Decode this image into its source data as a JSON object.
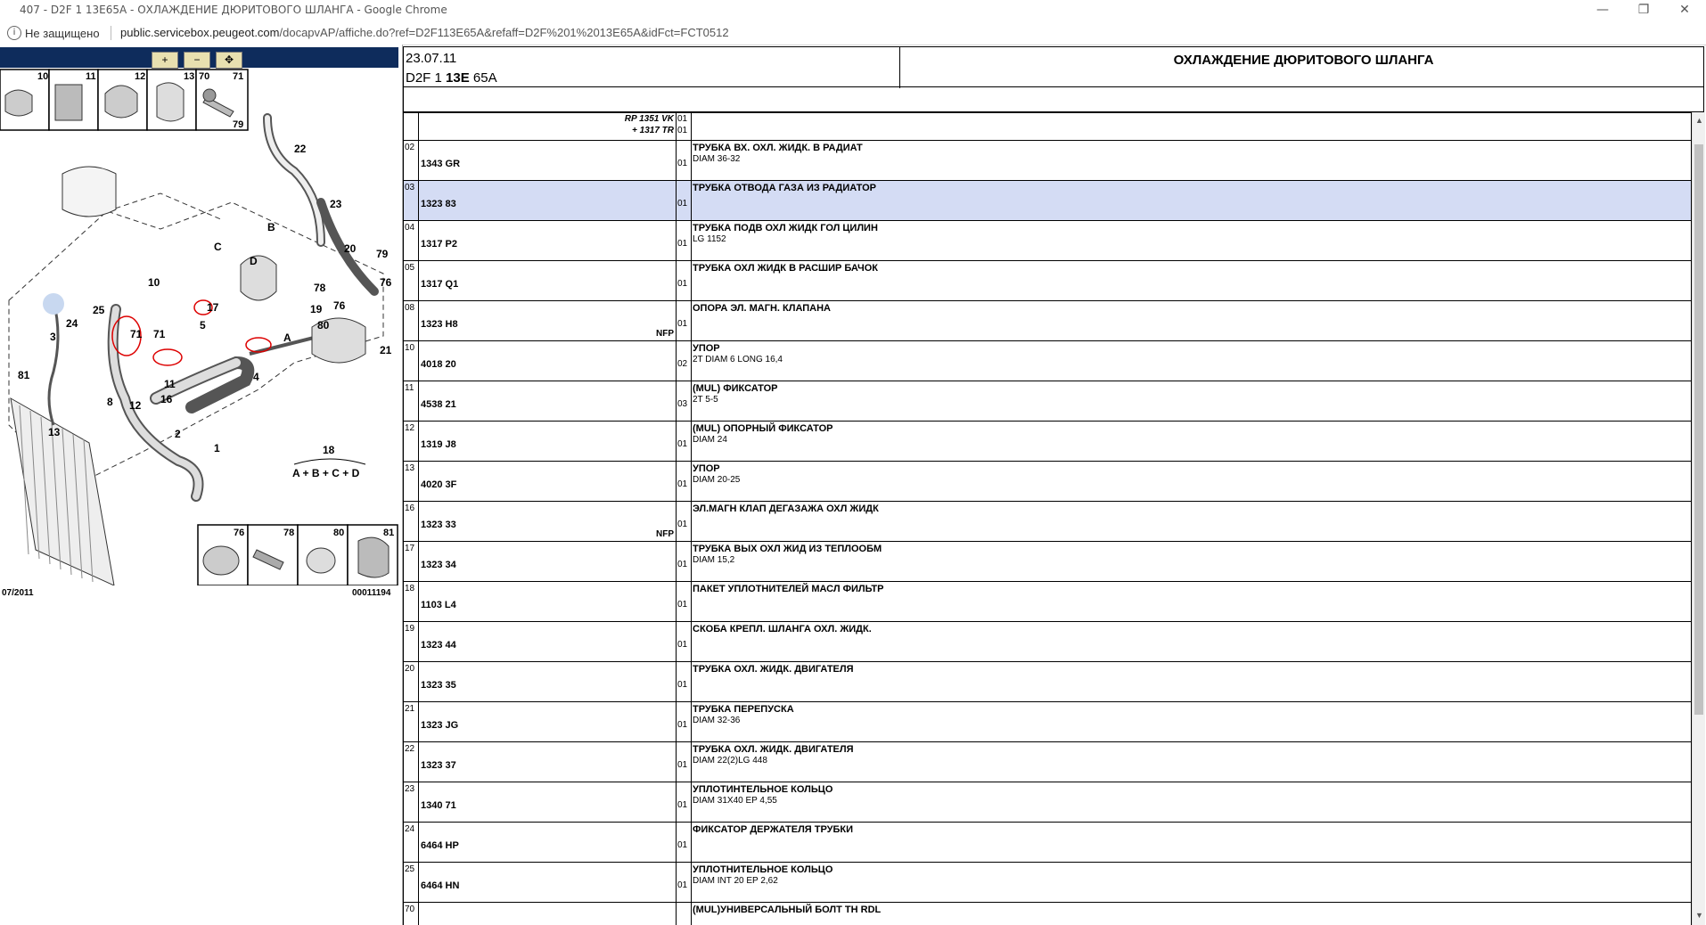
{
  "window": {
    "title": "407 - D2F 1 13E65A - ОХЛАЖДЕНИЕ ДЮРИТОВОГО ШЛАНГА - Google Chrome",
    "controls": {
      "minimize": "—",
      "restore": "❐",
      "close": "✕"
    }
  },
  "address_bar": {
    "security": "Не защищено",
    "url_host": "public.servicebox.peugeot.com",
    "url_path": "/docapvAP/affiche.do?ref=D2F113E65A&refaff=D2F%201%2013E65A&idFct=FCT0512"
  },
  "toolbar": {
    "zoom_in": "+",
    "zoom_out": "−",
    "zoom_fit": "✥"
  },
  "diagram": {
    "date": "07/2011",
    "code": "00011194",
    "top_thumbs": [
      "10",
      "11",
      "12",
      "13",
      "70",
      "71",
      "79"
    ],
    "bottom_thumbs": [
      "76",
      "78",
      "80",
      "81"
    ],
    "kit_label": "18",
    "kit_formula": "A + B + C + D",
    "callouts": [
      "22",
      "23",
      "20",
      "79",
      "76",
      "21",
      "76",
      "19",
      "78",
      "B",
      "C",
      "D",
      "A",
      "80",
      "10",
      "17",
      "5",
      "4",
      "25",
      "24",
      "3",
      "71",
      "71",
      "81",
      "8",
      "11",
      "16",
      "12",
      "13",
      "2",
      "1"
    ]
  },
  "header": {
    "date": "23.07.11",
    "code_prefix": "D2F 1 ",
    "code_bold": "13E",
    "code_suffix": " 65A",
    "page_title": "ОХЛАЖДЕНИЕ ДЮРИТОВОГО ШЛАНГА"
  },
  "top_row": {
    "rp_line1": "RP 1351 VK",
    "rp_line2": "+ 1317 TR",
    "qty1": "01",
    "qty2": "01"
  },
  "parts": [
    {
      "num": "02",
      "ref": "1343 GR",
      "nfp": "",
      "qty": "01",
      "desc": "ТРУБКА ВХ. ОХЛ. ЖИДК. В РАДИАТ",
      "detail": "DIAM 36-32",
      "highlight": false
    },
    {
      "num": "03",
      "ref": "1323 83",
      "nfp": "",
      "qty": "01",
      "desc": "ТРУБКА ОТВОДА ГАЗА ИЗ РАДИАТОР",
      "detail": "",
      "highlight": true
    },
    {
      "num": "04",
      "ref": "1317 P2",
      "nfp": "",
      "qty": "01",
      "desc": "ТРУБКА ПОДВ ОХЛ ЖИДК ГОЛ ЦИЛИН",
      "detail": "LG 1152",
      "highlight": false
    },
    {
      "num": "05",
      "ref": "1317 Q1",
      "nfp": "",
      "qty": "01",
      "desc": "ТРУБКА ОХЛ ЖИДК В РАСШИР БАЧОК",
      "detail": "",
      "highlight": false
    },
    {
      "num": "08",
      "ref": "1323 H8",
      "nfp": "NFP",
      "qty": "01",
      "desc": "ОПОРА ЭЛ. МАГН. КЛАПАНА",
      "detail": "",
      "highlight": false
    },
    {
      "num": "10",
      "ref": "4018 20",
      "nfp": "",
      "qty": "02",
      "desc": "УПОР",
      "detail": "2T DIAM 6 LONG 16,4",
      "highlight": false
    },
    {
      "num": "11",
      "ref": "4538 21",
      "nfp": "",
      "qty": "03",
      "desc": "(MUL) ФИКСАТОР",
      "detail": "2T 5-5",
      "highlight": false
    },
    {
      "num": "12",
      "ref": "1319 J8",
      "nfp": "",
      "qty": "01",
      "desc": "(MUL) ОПОРНЫЙ ФИКСАТОР",
      "detail": "DIAM 24",
      "highlight": false
    },
    {
      "num": "13",
      "ref": "4020 3F",
      "nfp": "",
      "qty": "01",
      "desc": "УПОР",
      "detail": "DIAM 20-25",
      "highlight": false
    },
    {
      "num": "16",
      "ref": "1323 33",
      "nfp": "NFP",
      "qty": "01",
      "desc": "ЭЛ.МАГН КЛАП ДЕГАЗАЖА ОХЛ ЖИДК",
      "detail": "",
      "highlight": false
    },
    {
      "num": "17",
      "ref": "1323 34",
      "nfp": "",
      "qty": "01",
      "desc": "ТРУБКА ВЫХ ОХЛ ЖИД ИЗ ТЕПЛООБМ",
      "detail": "DIAM 15,2",
      "highlight": false
    },
    {
      "num": "18",
      "ref": "1103 L4",
      "nfp": "",
      "qty": "01",
      "desc": "ПАКЕТ УПЛОТНИТЕЛЕЙ МАСЛ ФИЛЬТР",
      "detail": "",
      "highlight": false
    },
    {
      "num": "19",
      "ref": "1323 44",
      "nfp": "",
      "qty": "01",
      "desc": "СКОБА КРЕПЛ. ШЛАНГА ОХЛ. ЖИДК.",
      "detail": "",
      "highlight": false
    },
    {
      "num": "20",
      "ref": "1323 35",
      "nfp": "",
      "qty": "01",
      "desc": "ТРУБКА ОХЛ. ЖИДК. ДВИГАТЕЛЯ",
      "detail": "",
      "highlight": false
    },
    {
      "num": "21",
      "ref": "1323 JG",
      "nfp": "",
      "qty": "01",
      "desc": "ТРУБКА ПЕРЕПУСКА",
      "detail": "DIAM 32-36",
      "highlight": false
    },
    {
      "num": "22",
      "ref": "1323 37",
      "nfp": "",
      "qty": "01",
      "desc": "ТРУБКА ОХЛ. ЖИДК. ДВИГАТЕЛЯ",
      "detail": "DIAM 22(2)LG 448",
      "highlight": false
    },
    {
      "num": "23",
      "ref": "1340 71",
      "nfp": "",
      "qty": "01",
      "desc": "УПЛОТИНТЕЛЬНОЕ КОЛЬЦО",
      "detail": "DIAM 31X40 EP 4,55",
      "highlight": false
    },
    {
      "num": "24",
      "ref": "6464 HP",
      "nfp": "",
      "qty": "01",
      "desc": "ФИКСАТОР ДЕРЖАТЕЛЯ ТРУБКИ",
      "detail": "",
      "highlight": false
    },
    {
      "num": "25",
      "ref": "6464 HN",
      "nfp": "",
      "qty": "01",
      "desc": "УПЛОТНИТЕЛЬНОЕ КОЛЬЦО",
      "detail": "DIAM INT 20 EP 2,62",
      "highlight": false
    },
    {
      "num": "70",
      "ref": "",
      "nfp": "",
      "qty": "",
      "desc": "(MUL)УНИВЕРСАЛЬНЫЙ БОЛТ TH RDL",
      "detail": "",
      "highlight": false
    }
  ]
}
